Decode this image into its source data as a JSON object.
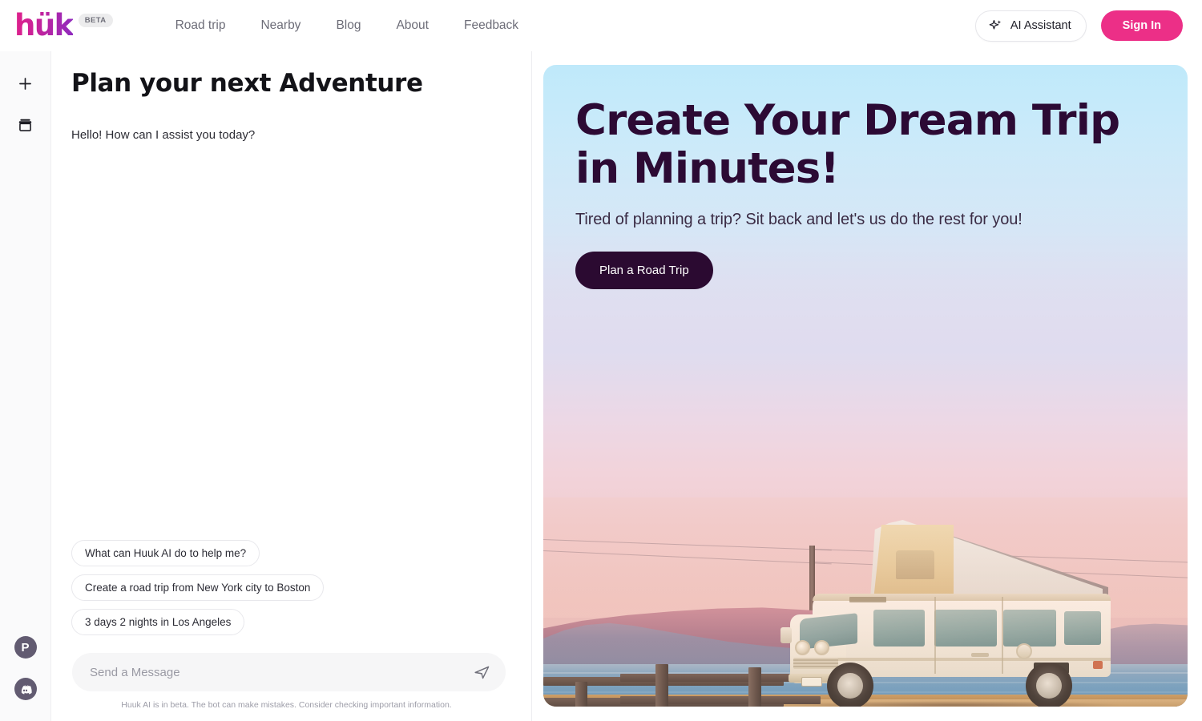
{
  "brand": {
    "logo_text": "hük",
    "badge": "BETA",
    "accent_pink": "#ec2f87",
    "accent_purple": "#8e2bbf",
    "hero_dark": "#2b0a31"
  },
  "nav": {
    "links": [
      {
        "label": "Road trip",
        "name": "nav-link-road-trip"
      },
      {
        "label": "Nearby",
        "name": "nav-link-nearby"
      },
      {
        "label": "Blog",
        "name": "nav-link-blog"
      },
      {
        "label": "About",
        "name": "nav-link-about"
      },
      {
        "label": "Feedback",
        "name": "nav-link-feedback"
      }
    ],
    "ai_assistant_label": "AI Assistant",
    "ai_assistant_icon": "sparkle-icon",
    "sign_in_label": "Sign In"
  },
  "rail": {
    "items": [
      {
        "icon": "plus-icon",
        "name": "new-chat-button"
      },
      {
        "icon": "archive-box-icon",
        "name": "saved-trips-button"
      }
    ],
    "social": [
      {
        "icon": "product-hunt-icon",
        "glyph": "P",
        "name": "product-hunt-link"
      },
      {
        "icon": "discord-icon",
        "glyph": "",
        "name": "discord-link"
      }
    ]
  },
  "chat": {
    "title": "Plan your next Adventure",
    "greeting": "Hello! How can I assist you today?",
    "suggestions": [
      "What can Huuk AI do to help me?",
      "Create a road trip from New York city to Boston",
      "3 days 2 nights in Los Angeles"
    ],
    "input_placeholder": "Send a Message",
    "input_value": "",
    "send_icon": "send-icon",
    "disclaimer": "Huuk AI is in beta. The bot can make mistakes. Consider checking important information."
  },
  "hero": {
    "heading": "Create Your Dream Trip in Minutes!",
    "subheading": "Tired of planning a trip? Sit back and let's us do the rest for you!",
    "cta_label": "Plan a Road Trip",
    "image_alt": "camper-van-at-sunset-by-the-coast"
  }
}
